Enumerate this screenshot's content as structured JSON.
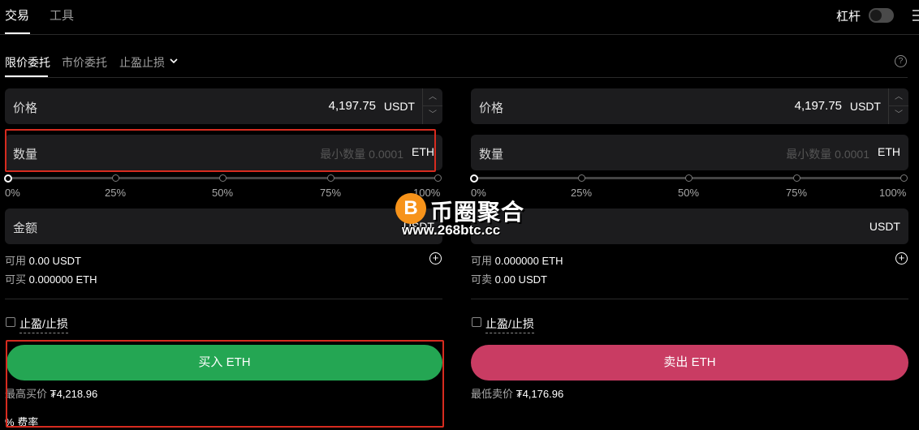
{
  "top_tabs": [
    {
      "label": "交易",
      "active": true
    },
    {
      "label": "工具",
      "active": false
    }
  ],
  "leverage": {
    "label": "杠杆",
    "enabled": false
  },
  "order_tabs": [
    {
      "label": "限价委托",
      "active": true
    },
    {
      "label": "市价委托",
      "active": false
    },
    {
      "label": "止盈止损",
      "active": false
    }
  ],
  "icons": {
    "help": "?",
    "chevron_down": "chevron-down-icon",
    "plus": "+",
    "stepper_up": "︿",
    "stepper_down": "﹀",
    "percent": "%"
  },
  "buy": {
    "price_label": "价格",
    "price_value": "4,197.75",
    "price_unit": "USDT",
    "qty_label": "数量",
    "qty_placeholder": "最小数量 0.0001",
    "qty_unit": "ETH",
    "slider": {
      "value_percent": 0,
      "labels": [
        "0%",
        "25%",
        "50%",
        "75%",
        "100%"
      ]
    },
    "amount_label": "金额",
    "amount_unit": "USDT",
    "available_label": "可用",
    "available_value": "0.00 USDT",
    "can_buy_label": "可买",
    "can_buy_value": "0.000000 ETH",
    "tpsl_label": "止盈/止损",
    "tpsl_checked": false,
    "action_label": "买入 ETH",
    "best_label": "最高买价",
    "best_value": "₮4,218.96",
    "fee_label": "费率"
  },
  "sell": {
    "price_label": "价格",
    "price_value": "4,197.75",
    "price_unit": "USDT",
    "qty_label": "数量",
    "qty_placeholder": "最小数量 0.0001",
    "qty_unit": "ETH",
    "slider": {
      "value_percent": 0,
      "labels": [
        "0%",
        "25%",
        "50%",
        "75%",
        "100%"
      ]
    },
    "amount_unit": "USDT",
    "available_label": "可用",
    "available_value": "0.000000 ETH",
    "can_sell_label": "可卖",
    "can_sell_value": "0.00 USDT",
    "tpsl_label": "止盈/止损",
    "tpsl_checked": false,
    "action_label": "卖出 ETH",
    "best_label": "最低卖价",
    "best_value": "₮4,176.96"
  },
  "watermark": {
    "logo_glyph": "B",
    "title": "币圈聚合",
    "url": "www.268btc.cc"
  },
  "colors": {
    "buy": "#24a653",
    "sell": "#c93c63",
    "highlight_box": "#d62b1f",
    "watermark_logo": "#f7931a"
  }
}
